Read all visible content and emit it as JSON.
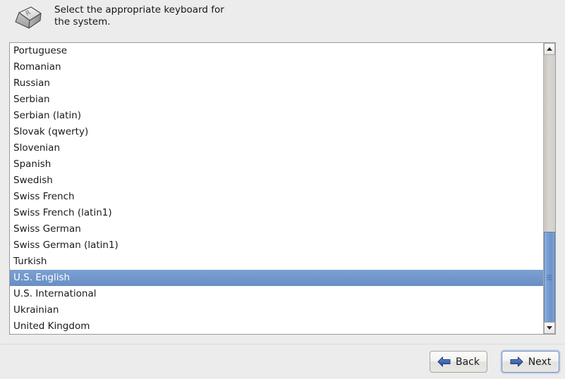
{
  "header": {
    "icon": "keyboard-key-icon",
    "text_line1": "Select the appropriate keyboard for",
    "text_line2": "the system."
  },
  "list": {
    "name": "keyboard-layout-list",
    "selected_value": "U.S. English",
    "items": [
      "Portuguese",
      "Romanian",
      "Russian",
      "Serbian",
      "Serbian (latin)",
      "Slovak (qwerty)",
      "Slovenian",
      "Spanish",
      "Swedish",
      "Swiss French",
      "Swiss French (latin1)",
      "Swiss German",
      "Swiss German (latin1)",
      "Turkish",
      "U.S. English",
      "U.S. International",
      "Ukrainian",
      "United Kingdom"
    ]
  },
  "scrollbar": {
    "up_arrow_icon": "chevron-up-icon",
    "down_arrow_icon": "chevron-down-icon",
    "grip_icon": "grip-lines-icon"
  },
  "footer": {
    "back_label": "Back",
    "back_icon": "arrow-left-icon",
    "next_label": "Next",
    "next_icon": "arrow-right-icon"
  },
  "colors": {
    "window_background": "#ececec",
    "list_background": "#ffffff",
    "selection_blue": "#6f93ca",
    "scrollbar_thumb_blue": "#7ba0d5",
    "focus_ring": "#6f8dbe"
  }
}
